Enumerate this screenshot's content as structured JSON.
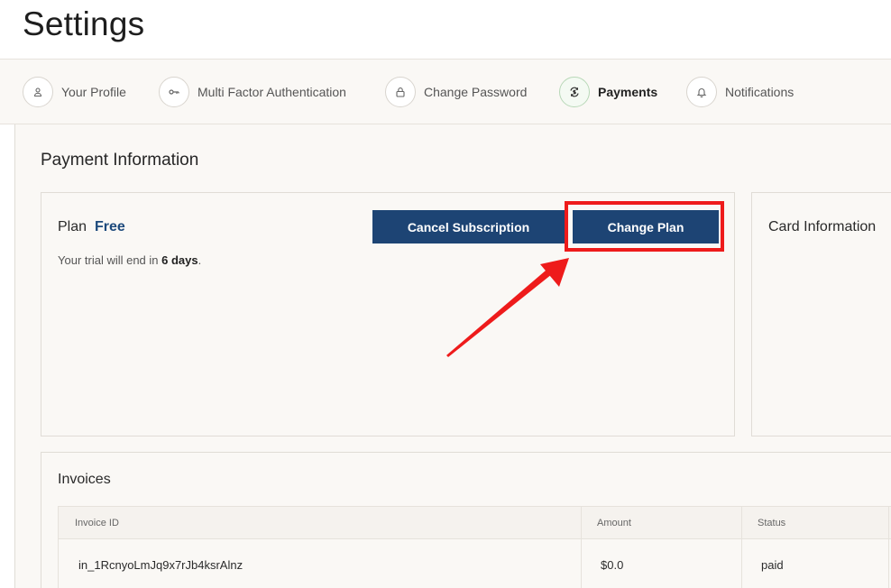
{
  "page": {
    "title": "Settings"
  },
  "tabs": [
    {
      "label": "Your Profile",
      "icon": "user-icon"
    },
    {
      "label": "Multi Factor Authentication",
      "icon": "key-icon"
    },
    {
      "label": "Change Password",
      "icon": "lock-icon"
    },
    {
      "label": "Payments",
      "icon": "payments-icon",
      "active": true
    },
    {
      "label": "Notifications",
      "icon": "bell-icon"
    }
  ],
  "payment": {
    "section_title": "Payment Information",
    "plan_label": "Plan",
    "plan_value": "Free",
    "trial_prefix": "Your trial will end in ",
    "trial_days": "6 days",
    "trial_suffix": ".",
    "cancel_label": "Cancel Subscription",
    "change_label": "Change Plan",
    "card_info_title": "Card Information"
  },
  "invoices": {
    "title": "Invoices",
    "columns": [
      "Invoice ID",
      "Amount",
      "Status"
    ],
    "rows": [
      {
        "id": "in_1RcnyoLmJq9x7rJb4ksrAlnz",
        "amount": "$0.0",
        "status": "paid"
      }
    ]
  },
  "colors": {
    "accent": "#1d4474",
    "plan_value": "#1d4a7c",
    "highlight": "#ee1b1b"
  }
}
